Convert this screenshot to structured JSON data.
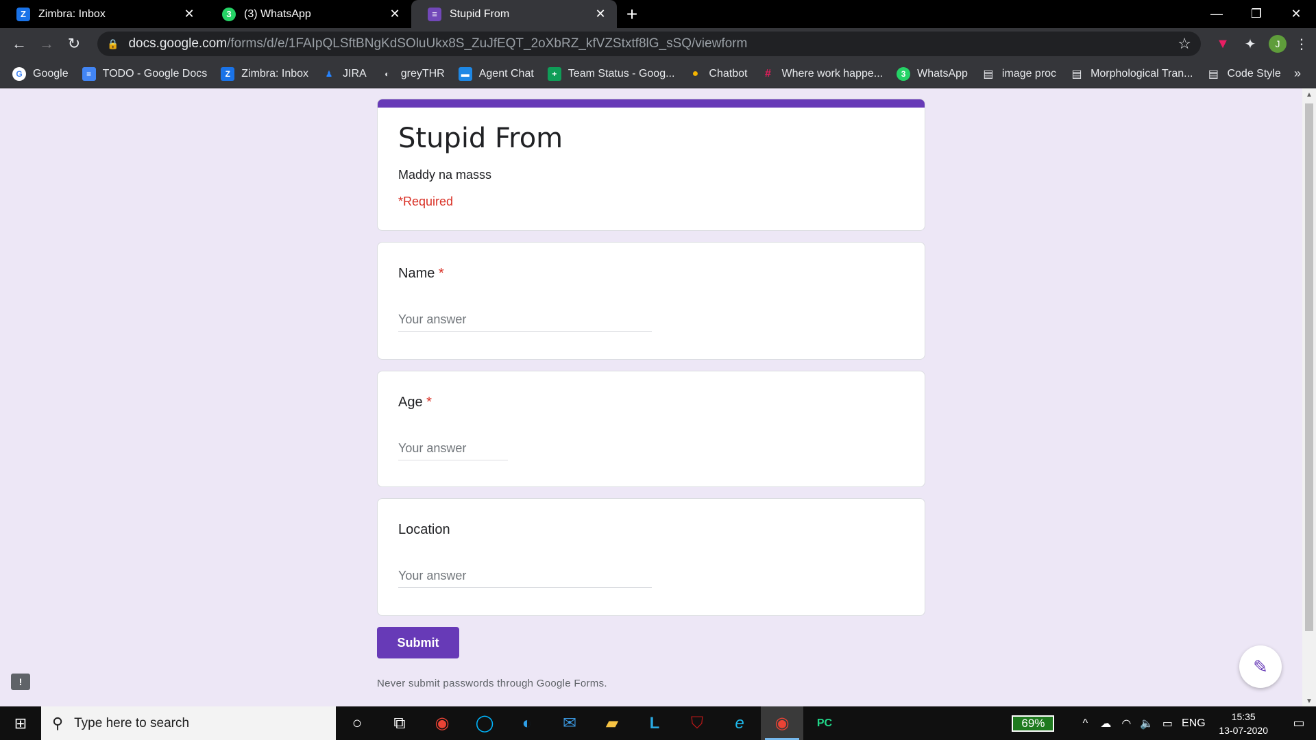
{
  "tabs": [
    {
      "title": "Zimbra: Inbox",
      "icon": "zimbra-icon",
      "glyph": "Z",
      "active": false
    },
    {
      "title": "(3) WhatsApp",
      "icon": "whatsapp-icon",
      "glyph": "3",
      "active": false
    },
    {
      "title": "Stupid From",
      "icon": "google-forms-icon",
      "glyph": "≡",
      "active": true
    }
  ],
  "address_bar": {
    "host": "docs.google.com",
    "path": "/forms/d/e/1FAIpQLSftBNgKdSOluUkx8S_ZuJfEQT_2oXbRZ_kfVZStxtf8lG_sSQ/viewform"
  },
  "profile_initial": "J",
  "bookmarks": [
    {
      "label": "Google",
      "icon": "google-icon",
      "glyph": "G",
      "color": "#ffffff"
    },
    {
      "label": "TODO - Google Docs",
      "icon": "google-docs-icon",
      "glyph": "≡",
      "color": "#4285f4"
    },
    {
      "label": "Zimbra: Inbox",
      "icon": "zimbra-icon",
      "glyph": "Z",
      "color": "#1a73e8"
    },
    {
      "label": "JIRA",
      "icon": "jira-icon",
      "glyph": "♟",
      "color": "#35363a"
    },
    {
      "label": "greyTHR",
      "icon": "globe-icon",
      "glyph": "◐",
      "color": "#35363a"
    },
    {
      "label": "Agent Chat",
      "icon": "chat-icon",
      "glyph": "▬",
      "color": "#1e88e5"
    },
    {
      "label": "Team Status - Goog...",
      "icon": "google-sheets-icon",
      "glyph": "+",
      "color": "#0f9d58"
    },
    {
      "label": "Chatbot",
      "icon": "chatbot-icon",
      "glyph": "●",
      "color": "#f4b400"
    },
    {
      "label": "Where work happe...",
      "icon": "slack-icon",
      "glyph": "#",
      "color": "#35363a"
    },
    {
      "label": "WhatsApp",
      "icon": "whatsapp-icon",
      "glyph": "3",
      "color": "#25d366"
    },
    {
      "label": "image proc",
      "icon": "page-icon",
      "glyph": "▤",
      "color": "#35363a"
    },
    {
      "label": "Morphological Tran...",
      "icon": "page-icon",
      "glyph": "▤",
      "color": "#35363a"
    },
    {
      "label": "Code Style",
      "icon": "page-icon",
      "glyph": "▤",
      "color": "#35363a"
    }
  ],
  "form": {
    "title": "Stupid From",
    "description": "Maddy na masss",
    "required_note": "*Required",
    "accent": "#673ab7",
    "questions": [
      {
        "label": "Name",
        "required": "*",
        "placeholder": "Your answer"
      },
      {
        "label": "Age",
        "required": "*",
        "placeholder": "Your answer"
      },
      {
        "label": "Location",
        "required": "",
        "placeholder": "Your answer"
      }
    ],
    "submit_label": "Submit",
    "disclaimer": "Never submit passwords through Google Forms."
  },
  "taskbar": {
    "search_placeholder": "Type here to search",
    "battery": "69%",
    "language": "ENG",
    "time": "15:35",
    "date": "13-07-2020"
  }
}
